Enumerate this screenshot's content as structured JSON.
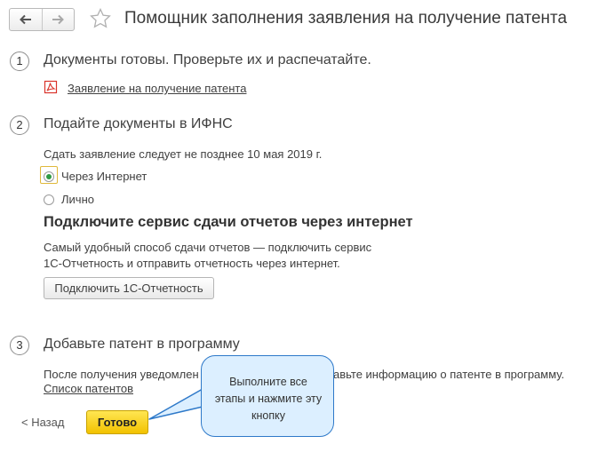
{
  "header": {
    "back_icon": "arrow-left-icon",
    "forward_icon": "arrow-right-icon",
    "favorite_icon": "star-icon",
    "title": "Помощник заполнения заявления на получение патента"
  },
  "step1": {
    "number": "1",
    "title": "Документы готовы. Проверьте их и распечатайте.",
    "document_icon": "pdf-icon",
    "document_link": "Заявление на получение патента"
  },
  "step2": {
    "number": "2",
    "title": "Подайте документы в ИФНС",
    "deadline_text": "Сдать заявление следует не позднее 10 мая 2019 г.",
    "options": [
      {
        "label": "Через Интернет",
        "selected": true
      },
      {
        "label": "Лично",
        "selected": false
      }
    ],
    "service_heading": "Подключите сервис сдачи отчетов через интернет",
    "service_description_line1": "Самый удобный способ сдачи отчетов — подключить сервис",
    "service_description_line2": "1С-Отчетность и отправить отчетность через интернет.",
    "connect_button": "Подключить 1С-Отчетность"
  },
  "step3": {
    "number": "3",
    "title": "Добавьте патент в программу",
    "description_left": "После получения уведомлен",
    "description_right": "авьте информацию о патенте в программу.",
    "patents_link": "Список патентов"
  },
  "footer": {
    "back_label": "< Назад",
    "done_button": "Готово"
  },
  "callout": {
    "line1": "Выполните все",
    "line2": "этапы и нажмите эту",
    "line3": "кнопку"
  },
  "colors": {
    "link": "#1f58a9",
    "done_button": "#f2c200",
    "radio_selected": "#2f9a44",
    "callout_fill": "#dcefff",
    "callout_border": "#2e79c9",
    "pdf_icon": "#d9342b"
  }
}
